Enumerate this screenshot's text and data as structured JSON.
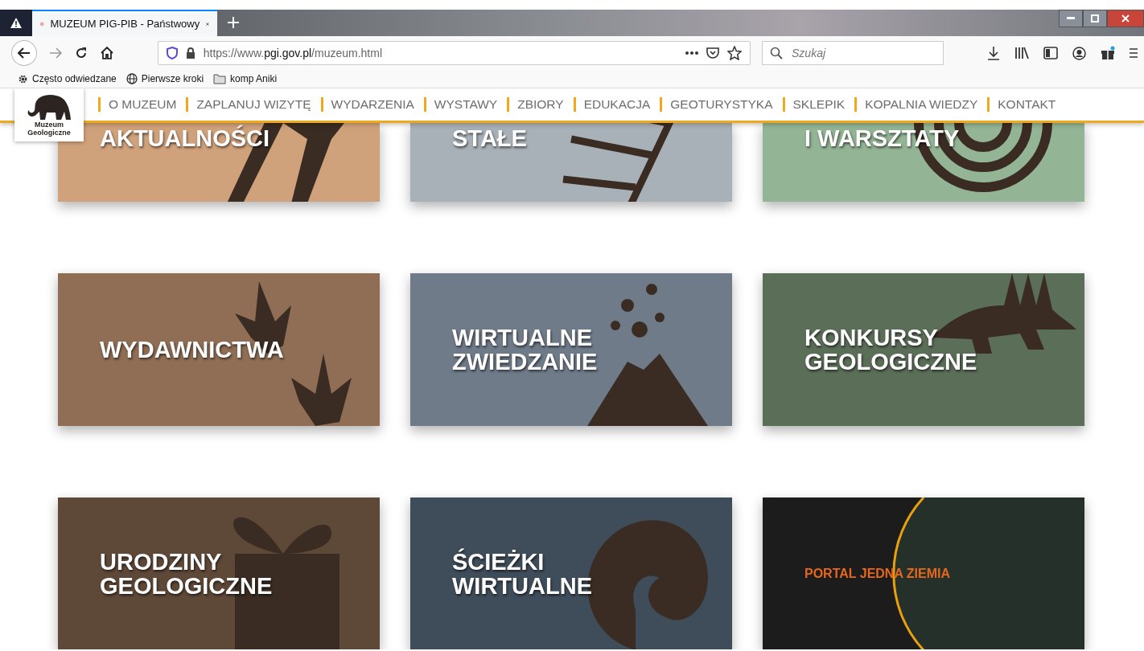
{
  "browser": {
    "tab_title": "MUZEUM PIG-PIB - Państwowy",
    "url_prefix": "https://www.",
    "url_domain": "pgi.gov.pl",
    "url_path": "/muzeum.html",
    "search_placeholder": "Szukaj",
    "bookmarks": [
      "Często odwiedzane",
      "Pierwsze kroki",
      "komp Aniki"
    ]
  },
  "site": {
    "logo_text": "Muzeum Geologiczne",
    "nav": [
      "O MUZEUM",
      "ZAPLANUJ WIZYTĘ",
      "WYDARZENIA",
      "WYSTAWY",
      "ZBIORY",
      "EDUKACJA",
      "GEOTURYSTYKA",
      "SKLEPIK",
      "KOPALNIA WIEDZY",
      "KONTAKT"
    ],
    "tiles": [
      {
        "label": "AKTUALNOŚCI",
        "color": "#d0a27c",
        "kind": "standard"
      },
      {
        "label": "STAŁE",
        "color": "#a9b1b8",
        "kind": "standard"
      },
      {
        "label": "I WARSZTATY",
        "color": "#93b595",
        "kind": "standard"
      },
      {
        "label": "WYDAWNICTWA",
        "color": "#8f6e55",
        "kind": "standard"
      },
      {
        "label": "WIRTUALNE ZWIEDZANIE",
        "color": "#6f7b89",
        "kind": "standard"
      },
      {
        "label": "KONKURSY GEOLOGICZNE",
        "color": "#5b6e58",
        "kind": "standard"
      },
      {
        "label": "URODZINY GEOLOGICZNE",
        "color": "#5e4838",
        "kind": "standard"
      },
      {
        "label": "ŚCIEŻKI WIRTUALNE",
        "color": "#3f4d5a",
        "kind": "standard"
      },
      {
        "label": "PORTAL JEDNA ZIEMIA",
        "color": "#1c1c1c",
        "kind": "portal"
      }
    ]
  }
}
